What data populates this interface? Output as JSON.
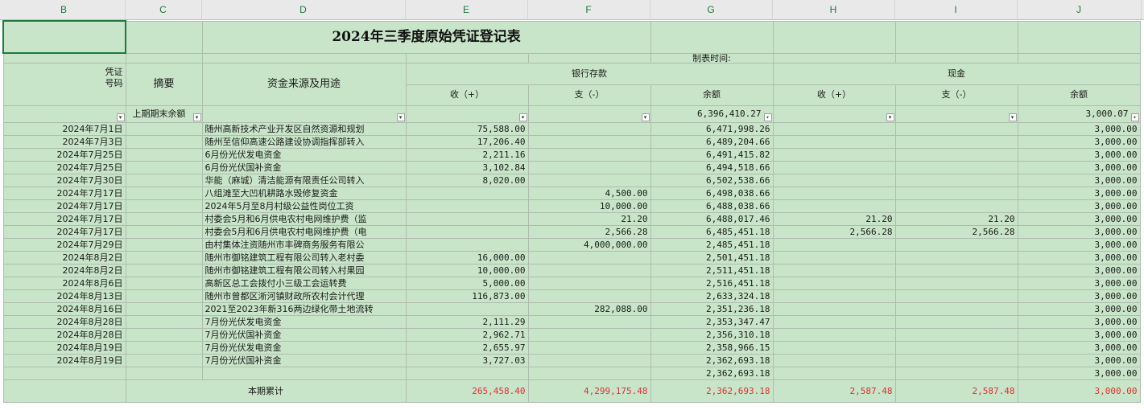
{
  "columns": [
    "B",
    "C",
    "D",
    "E",
    "F",
    "G",
    "H",
    "I",
    "J"
  ],
  "title": "2024年三季度原始凭证登记表",
  "made_time_label": "制表时间:",
  "header": {
    "voucher_line1": "凭证",
    "voucher_line2": "号码",
    "summary": "摘要",
    "source_use": "资金来源及用途",
    "bank": "银行存款",
    "cash": "现金",
    "income": "收（+）",
    "expense": "支（-）",
    "balance": "余额"
  },
  "filter_row": {
    "summary_label": "上期期末余额",
    "bank_balance": "6,396,410.27",
    "cash_balance": "3,000.07"
  },
  "filter_glyph": "▾",
  "rows": [
    {
      "date": "2024年7月1日",
      "desc": "随州高新技术产业开发区自然资源和规划",
      "bank_in": "75,588.00",
      "bank_out": "",
      "bank_bal": "6,471,998.26",
      "cash_in": "",
      "cash_out": "",
      "cash_bal": "3,000.00"
    },
    {
      "date": "2024年7月3日",
      "desc": "随州至信仰高速公路建设协调指挥部转入",
      "bank_in": "17,206.40",
      "bank_out": "",
      "bank_bal": "6,489,204.66",
      "cash_in": "",
      "cash_out": "",
      "cash_bal": "3,000.00"
    },
    {
      "date": "2024年7月25日",
      "desc": "6月份光伏发电资金",
      "bank_in": "2,211.16",
      "bank_out": "",
      "bank_bal": "6,491,415.82",
      "cash_in": "",
      "cash_out": "",
      "cash_bal": "3,000.00"
    },
    {
      "date": "2024年7月25日",
      "desc": "6月份光伏国补资金",
      "bank_in": "3,102.84",
      "bank_out": "",
      "bank_bal": "6,494,518.66",
      "cash_in": "",
      "cash_out": "",
      "cash_bal": "3,000.00"
    },
    {
      "date": "2024年7月30日",
      "desc": "华能（麻城）清洁能源有限责任公司转入",
      "bank_in": "8,020.00",
      "bank_out": "",
      "bank_bal": "6,502,538.66",
      "cash_in": "",
      "cash_out": "",
      "cash_bal": "3,000.00"
    },
    {
      "date": "2024年7月17日",
      "desc": "八组滩至大凹机耕路水毁修复资金",
      "bank_in": "",
      "bank_out": "4,500.00",
      "bank_bal": "6,498,038.66",
      "cash_in": "",
      "cash_out": "",
      "cash_bal": "3,000.00"
    },
    {
      "date": "2024年7月17日",
      "desc": "2024年5月至8月村级公益性岗位工资",
      "bank_in": "",
      "bank_out": "10,000.00",
      "bank_bal": "6,488,038.66",
      "cash_in": "",
      "cash_out": "",
      "cash_bal": "3,000.00"
    },
    {
      "date": "2024年7月17日",
      "desc": "村委会5月和6月供电农村电网维护费（监",
      "bank_in": "",
      "bank_out": "21.20",
      "bank_bal": "6,488,017.46",
      "cash_in": "21.20",
      "cash_out": "21.20",
      "cash_bal": "3,000.00"
    },
    {
      "date": "2024年7月17日",
      "desc": "村委会5月和6月供电农村电网维护费（电",
      "bank_in": "",
      "bank_out": "2,566.28",
      "bank_bal": "6,485,451.18",
      "cash_in": "2,566.28",
      "cash_out": "2,566.28",
      "cash_bal": "3,000.00"
    },
    {
      "date": "2024年7月29日",
      "desc": "由村集体注资随州市丰碑商务服务有限公",
      "bank_in": "",
      "bank_out": "4,000,000.00",
      "bank_bal": "2,485,451.18",
      "cash_in": "",
      "cash_out": "",
      "cash_bal": "3,000.00"
    },
    {
      "date": "2024年8月2日",
      "desc": "随州市御铭建筑工程有限公司转入老村委",
      "bank_in": "16,000.00",
      "bank_out": "",
      "bank_bal": "2,501,451.18",
      "cash_in": "",
      "cash_out": "",
      "cash_bal": "3,000.00"
    },
    {
      "date": "2024年8月2日",
      "desc": "随州市御铭建筑工程有限公司转入村果园",
      "bank_in": "10,000.00",
      "bank_out": "",
      "bank_bal": "2,511,451.18",
      "cash_in": "",
      "cash_out": "",
      "cash_bal": "3,000.00"
    },
    {
      "date": "2024年8月6日",
      "desc": "高新区总工会拨付小三级工会运转费",
      "bank_in": "5,000.00",
      "bank_out": "",
      "bank_bal": "2,516,451.18",
      "cash_in": "",
      "cash_out": "",
      "cash_bal": "3,000.00"
    },
    {
      "date": "2024年8月13日",
      "desc": "随州市曾都区淅河镇财政所农村会计代理",
      "bank_in": "116,873.00",
      "bank_out": "",
      "bank_bal": "2,633,324.18",
      "cash_in": "",
      "cash_out": "",
      "cash_bal": "3,000.00"
    },
    {
      "date": "2024年8月16日",
      "desc": "2021至2023年新316两边绿化带土地流转",
      "bank_in": "",
      "bank_out": "282,088.00",
      "bank_bal": "2,351,236.18",
      "cash_in": "",
      "cash_out": "",
      "cash_bal": "3,000.00"
    },
    {
      "date": "2024年8月28日",
      "desc": "7月份光伏发电资金",
      "bank_in": "2,111.29",
      "bank_out": "",
      "bank_bal": "2,353,347.47",
      "cash_in": "",
      "cash_out": "",
      "cash_bal": "3,000.00"
    },
    {
      "date": "2024年8月28日",
      "desc": "7月份光伏国补资金",
      "bank_in": "2,962.71",
      "bank_out": "",
      "bank_bal": "2,356,310.18",
      "cash_in": "",
      "cash_out": "",
      "cash_bal": "3,000.00"
    },
    {
      "date": "2024年8月19日",
      "desc": "7月份光伏发电资金",
      "bank_in": "2,655.97",
      "bank_out": "",
      "bank_bal": "2,358,966.15",
      "cash_in": "",
      "cash_out": "",
      "cash_bal": "3,000.00"
    },
    {
      "date": "2024年8月19日",
      "desc": "7月份光伏国补资金",
      "bank_in": "3,727.03",
      "bank_out": "",
      "bank_bal": "2,362,693.18",
      "cash_in": "",
      "cash_out": "",
      "cash_bal": "3,000.00"
    },
    {
      "date": "",
      "desc": "",
      "bank_in": "",
      "bank_out": "",
      "bank_bal": "2,362,693.18",
      "cash_in": "",
      "cash_out": "",
      "cash_bal": "3,000.00"
    }
  ],
  "totals": {
    "label": "本期累计",
    "bank_in": "265,458.40",
    "bank_out": "4,299,175.48",
    "bank_bal": "2,362,693.18",
    "cash_in": "2,587.48",
    "cash_out": "2,587.48",
    "cash_bal": "3,000.00"
  },
  "colors": {
    "cell_bg": "#c9e5c9",
    "balance_bg": "#e0eedf",
    "header_text": "#1e7a3e",
    "total_red": "#e03030"
  }
}
